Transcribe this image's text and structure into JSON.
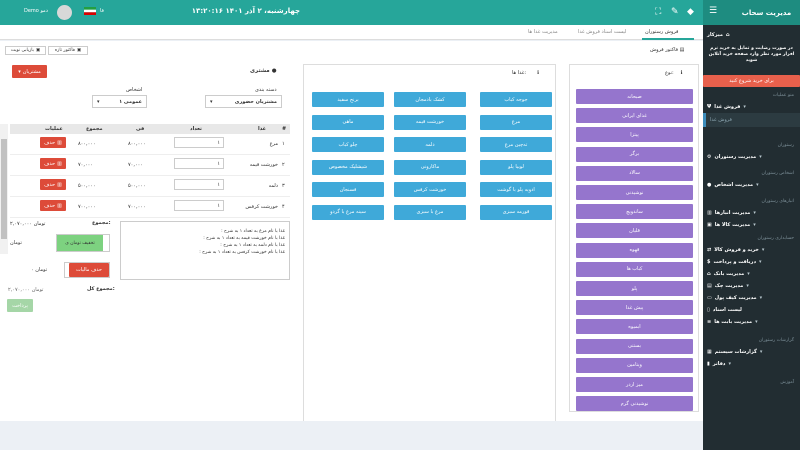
{
  "header": {
    "datetime": "چهارشنبه، ۲ آذر ۱۴۰۱ ۱۳:۲۰:۱۶",
    "user_name": "Demo دمو",
    "flag_label": "فا"
  },
  "sidebar": {
    "title": "مدیریت سحاب",
    "dashboard": "میزکار",
    "promo": "در صورت رضایت و تمایل به خرید نرم افزار مورد نظر وارد صفحه خرید آنلاین شوید",
    "buy_button": "برای خرید شروع کنید",
    "menu_header": "منو عملیات",
    "food_sales": "فروش غذا",
    "food_sales_sub": "فروش غذا",
    "restaurant_header": "رستوران",
    "restaurant_mgmt": "مدیریت رستوران",
    "persons_header": "اشخاص رستوران",
    "persons_mgmt": "مدیریت اشخاص",
    "warehouse_header": "انبارهای رستوران",
    "warehouses_mgmt": "مدیریت انبارها",
    "goods_mgmt": "مدیریت کالا ها",
    "accounting_header": "حسابداری رستوران",
    "buy_sell": "خرید و فروش کالا",
    "receive_pay": "دریافت و پرداخت",
    "bank_mgmt": "مدیریت بانک",
    "check_mgmt": "مدیریت چک",
    "cash_mgmt": "مدیریت کیف پول",
    "docs_list": "لیست اسناد",
    "accounts_mgmt": "مدیریت بابت ها",
    "reports_header": "گزارشات رستوران",
    "system_reports": "گزارشات سیستم",
    "ledgers": "دفاتر",
    "training_header": "آموزش"
  },
  "tabs": [
    "فروش رستوران",
    "لیست اسناد فروش غذا",
    "مدیریت غذا ها"
  ],
  "toolbar": {
    "invoice_label": "فاکتور فروش",
    "new_invoice": "فاکتور تازه",
    "reload_invoice": "بازیابی نوبت"
  },
  "customer": {
    "title": "مشتری",
    "customers_button": "مشتریان",
    "category_label": "دسته بندی",
    "category_value": "مشتریان حضوری",
    "persons_label": "اشخاص",
    "persons_value": "عمومی ۱"
  },
  "order_table": {
    "headers": [
      "#",
      "غذا",
      "تعداد",
      "فی",
      "مجموع",
      "عملیات"
    ],
    "delete_label": "حذف",
    "rows": [
      {
        "n": "۱",
        "food": "مرغ",
        "qty": "۱",
        "price": "۸۰۰,۰۰۰",
        "total": "۸۰۰,۰۰۰"
      },
      {
        "n": "۲",
        "food": "خورشت قیمه",
        "qty": "۱",
        "price": "۷۰,۰۰۰",
        "total": "۷۰,۰۰۰"
      },
      {
        "n": "۳",
        "food": "دلمه",
        "qty": "۱",
        "price": "۵۰۰,۰۰۰",
        "total": "۵۰۰,۰۰۰"
      },
      {
        "n": "۴",
        "food": "خورشت کرفس",
        "qty": "۱",
        "price": "۷۰۰,۰۰۰",
        "total": "۷۰۰,۰۰۰"
      }
    ]
  },
  "summary": {
    "sum_label": "مجموع:",
    "sum_value": "۲,۰۷۰,۰۰۰ تومان",
    "discount_button": "تخفیف تومان ی",
    "discount_unit": "تومان",
    "tax_button": "حذف مالیات",
    "tax_value": "۰ تومان",
    "total_label": "مجموع کل:",
    "total_value": "۲,۰۷۰,۰۰۰ تومان",
    "pay_button": "پرداخت"
  },
  "notes": [
    "غذا با نام مرغ  به تعداد ۱ به شرح :",
    "غذا با نام خورشت قیمه  به تعداد ۱ به شرح :",
    "غذا با نام دلمه به تعداد ۱ به شرح :",
    "غذا با نام خورشت کرفس  به تعداد ۱ به شرح :"
  ],
  "foods": {
    "title": "غذا ها:",
    "items": [
      "جوجه کباب",
      "کشک بادمجان",
      "برنج سفید",
      "مرغ",
      "خورشت قیمه",
      "ماهی",
      "ته‌چین مرغ",
      "دلمه",
      "چلو کباب",
      "لوبیا پلو",
      "ماکارونی",
      "شیشلیک مخصوص",
      "ادویه پلو با گوشت",
      "خورشت کرفس",
      "فسنجان",
      "قورمه سبزی",
      "مرغ با سبزی",
      "سینه مرغ با گردو"
    ]
  },
  "types": {
    "title": "نوع:",
    "items": [
      "صبحانه",
      "غذای ایرانی",
      "پیتزا",
      "برگر",
      "سالاد",
      "نوشیدنی",
      "ساندویچ",
      "قلیان",
      "قهوه",
      "کباب ها",
      "پلو",
      "پیش غذا",
      "ابمیوه",
      "بستنی",
      "ویتامین",
      "میز اردر",
      "نوشیدنی گرم"
    ]
  }
}
